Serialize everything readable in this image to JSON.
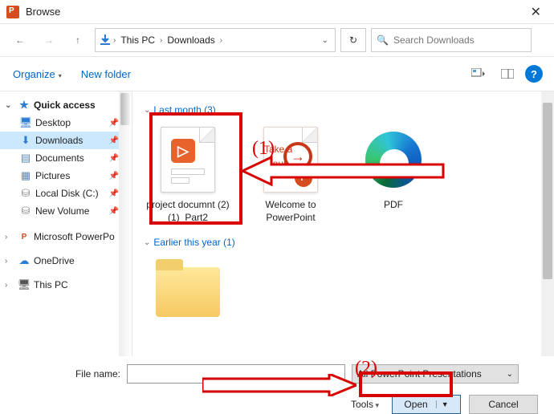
{
  "window": {
    "title": "Browse"
  },
  "nav": {
    "path_root": "This PC",
    "path_current": "Downloads",
    "search_placeholder": "Search Downloads"
  },
  "toolbar": {
    "organize": "Organize",
    "new_folder": "New folder"
  },
  "sidebar": {
    "quick_access": "Quick access",
    "items": [
      {
        "label": "Desktop",
        "pinned": true
      },
      {
        "label": "Downloads",
        "pinned": true,
        "selected": true
      },
      {
        "label": "Documents",
        "pinned": true
      },
      {
        "label": "Pictures",
        "pinned": true
      },
      {
        "label": "Local Disk (C:)",
        "pinned": true
      },
      {
        "label": "New Volume",
        "pinned": true
      }
    ],
    "ms_ppt": "Microsoft PowerPo",
    "onedrive": "OneDrive",
    "this_pc": "This PC"
  },
  "content": {
    "group1": {
      "header": "Last month (3)",
      "items": [
        {
          "label": "project documnt (2) (1)_Part2"
        },
        {
          "label": "Welcome to PowerPoint",
          "tour_line1": "Take a",
          "tour_line2": "tour"
        },
        {
          "label": "PDF"
        }
      ]
    },
    "group2": {
      "header": "Earlier this year (1)"
    }
  },
  "footer": {
    "file_name_label": "File name:",
    "file_name_value": "",
    "filter": "All PowerPoint Presentations",
    "tools": "Tools",
    "open": "Open",
    "cancel": "Cancel"
  },
  "annotations": {
    "num1": "(1)",
    "num2": "(2)"
  }
}
